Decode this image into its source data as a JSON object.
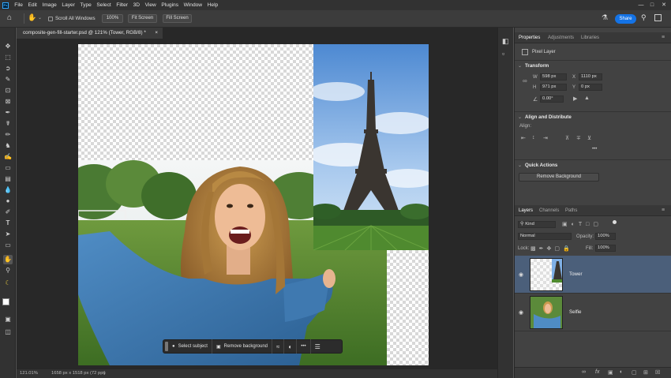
{
  "menubar": {
    "logo": "Ps",
    "items": [
      "File",
      "Edit",
      "Image",
      "Layer",
      "Type",
      "Select",
      "Filter",
      "3D",
      "View",
      "Plugins",
      "Window",
      "Help"
    ]
  },
  "optionsbar": {
    "scroll_all_windows": "Scroll All Windows",
    "zoom_100": "100%",
    "fit_screen": "Fit Screen",
    "fill_screen": "Fill Screen",
    "share": "Share"
  },
  "document": {
    "tab_title": "composite-gen-fill-starter.psd @ 121% (Tower, RGB/8) *",
    "status_zoom": "121.01%",
    "status_info": "1658 px x 1518 px (72 ppi)"
  },
  "contextual_taskbar": {
    "select_subject": "Select subject",
    "remove_background": "Remove background",
    "more": "•••"
  },
  "properties_panel": {
    "tabs": [
      "Properties",
      "Adjustments",
      "Libraries"
    ],
    "layer_type": "Pixel Layer",
    "transform": {
      "title": "Transform",
      "w_label": "W",
      "w_value": "598 px",
      "h_label": "H",
      "h_value": "971 px",
      "x_label": "X",
      "x_value": "1110 px",
      "y_label": "Y",
      "y_value": "0 px",
      "angle": "0.00°"
    },
    "align": {
      "title": "Align and Distribute",
      "align_label": "Align:",
      "more": "•••"
    },
    "quick_actions": {
      "title": "Quick Actions",
      "remove_background": "Remove Background"
    }
  },
  "layers_panel": {
    "tabs": [
      "Layers",
      "Channels",
      "Paths"
    ],
    "filter_kind": "Kind",
    "blend_mode": "Normal",
    "opacity_label": "Opacity:",
    "opacity_value": "100%",
    "lock_label": "Lock:",
    "fill_label": "Fill:",
    "fill_value": "100%",
    "layers": [
      {
        "name": "Tower",
        "selected": true
      },
      {
        "name": "Selfie",
        "selected": false
      }
    ]
  },
  "colors": {
    "accent": "#31a8ff",
    "selected_layer": "#4b5f7a",
    "share_button": "#1473e6"
  }
}
